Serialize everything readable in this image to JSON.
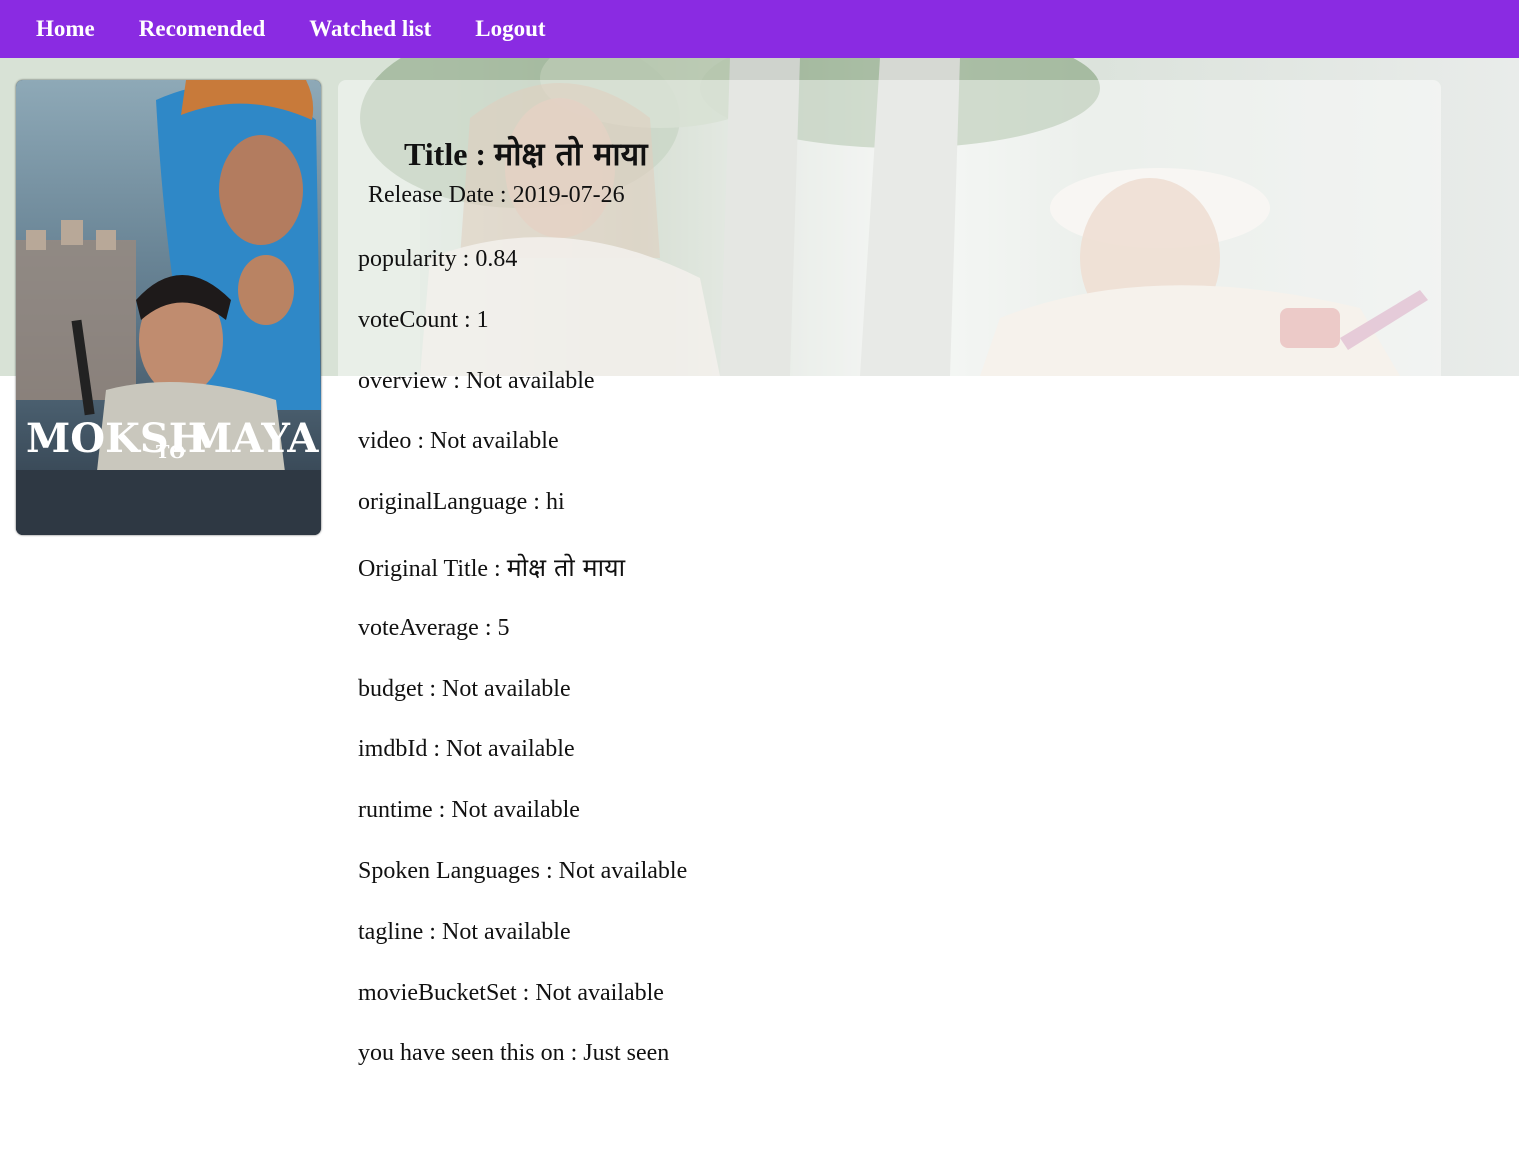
{
  "nav": {
    "items": [
      "Home",
      "Recomended",
      "Watched list",
      "Logout"
    ]
  },
  "poster": {
    "logo_text_1": "MOKSH",
    "logo_text_2": "TO",
    "logo_text_3": "MAYA"
  },
  "movie": {
    "title_label": "Title :",
    "title_value": "मोक्ष तो माया",
    "release_label": "Release Date :",
    "release_value": "2019-07-26",
    "fields": [
      {
        "label": "popularity :",
        "value": "0.84"
      },
      {
        "label": "voteCount :",
        "value": "1"
      },
      {
        "label": "overview :",
        "value": "Not available"
      },
      {
        "label": "video :",
        "value": "Not available"
      },
      {
        "label": "originalLanguage :",
        "value": "hi"
      },
      {
        "label": "Original Title :",
        "value": "मोक्ष तो माया"
      },
      {
        "label": "voteAverage :",
        "value": "5"
      },
      {
        "label": "budget :",
        "value": "Not available"
      },
      {
        "label": "imdbId :",
        "value": "Not available"
      },
      {
        "label": "runtime :",
        "value": "Not available"
      },
      {
        "label": "Spoken Languages :",
        "value": "Not available"
      },
      {
        "label": "tagline :",
        "value": "Not available"
      },
      {
        "label": "movieBucketSet :",
        "value": "Not available"
      },
      {
        "label": "you have seen this on :",
        "value": "Just seen"
      }
    ]
  },
  "colors": {
    "nav_bg": "#8a2be2",
    "nav_text": "#ffffff"
  }
}
